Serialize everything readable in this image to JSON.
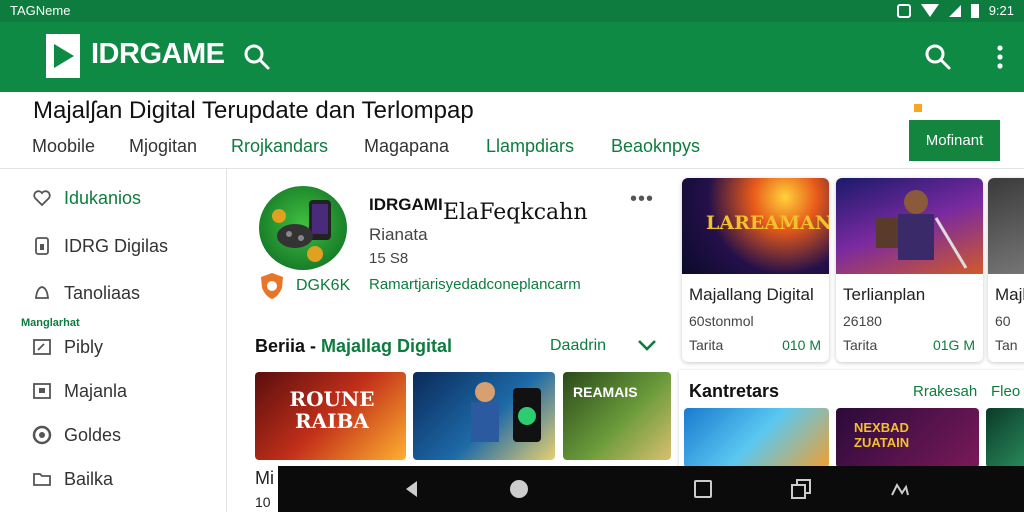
{
  "status_bar": {
    "carrier": "TAGNeme",
    "time": "9:21",
    "icons": [
      "vibrate-icon",
      "wifi-icon",
      "signal-icon",
      "battery-icon"
    ]
  },
  "app_bar": {
    "brand": "IDRGAME",
    "icons": [
      "search-icon",
      "search-icon",
      "more-vert-icon"
    ]
  },
  "header": {
    "title": "Majalʃan Digital Terupdate dan Terlompap",
    "tabs": [
      {
        "label": "Moobile",
        "active": false
      },
      {
        "label": "Mjogitan",
        "active": false
      },
      {
        "label": "Rrojkandars",
        "active": true
      },
      {
        "label": "Magapana",
        "active": false
      },
      {
        "label": "Llampdiars",
        "active": true
      },
      {
        "label": "Beaoknpys",
        "active": true
      }
    ],
    "install_button": "Mofinant"
  },
  "sidebar": {
    "items": [
      {
        "label": "Idukanios",
        "icon": "heart-icon",
        "active": true
      },
      {
        "label": "IDRG Digilas",
        "icon": "phone-icon",
        "active": false
      },
      {
        "label": "Tanoliaas",
        "icon": "bell-icon",
        "active": false
      },
      {
        "label": "Pibly",
        "icon": "external-icon",
        "active": false
      },
      {
        "label": "Majanla",
        "icon": "square-icon",
        "active": false
      },
      {
        "label": "Goldes",
        "icon": "circle-icon",
        "active": false
      },
      {
        "label": "Bailka",
        "icon": "folder-icon",
        "active": false
      }
    ],
    "section_heading": "Manglarhat"
  },
  "featured": {
    "name": "IDRGAMI",
    "overlay": "ElaFeqkcahn",
    "subtitle": "Rianata",
    "meta": "15 S8",
    "badge": "DGK6K",
    "link": "Ramartjarisyedadconeplancarm",
    "more": "•••"
  },
  "section": {
    "title_prefix": "Beriia - ",
    "title_green": "Majallag Digital",
    "link": "Daadrin",
    "thumbs": [
      {
        "text": "ROUNE RAIBA"
      },
      {
        "text": ""
      },
      {
        "text": "REAMAIS"
      }
    ],
    "below_label": "Mi",
    "below_meta": "10"
  },
  "cards": [
    {
      "title": "Majallang Digital",
      "meta": "60stonmol",
      "size": "Tarita",
      "price": "010 M",
      "art": "LAREAMAN"
    },
    {
      "title": "Terlianplan",
      "meta": "26180",
      "size": "Tarita",
      "price": "01G M",
      "art": ""
    },
    {
      "title": "Majl",
      "meta": "60",
      "size": "Tan",
      "price": "",
      "art": ""
    }
  ],
  "panel2": {
    "title": "Kantretars",
    "link": "Rrakesah",
    "link2": "Fleo",
    "art": "NEXBAD ZUATAIN"
  },
  "nav": {
    "icons": [
      "back-icon",
      "home-icon",
      "recents-icon",
      "multiwindow-icon",
      "assistant-icon"
    ]
  },
  "colors": {
    "primary": "#0f8a45",
    "status": "#0d7c3e",
    "accent_green": "#0d7c3e",
    "orange": "#f6a623"
  }
}
